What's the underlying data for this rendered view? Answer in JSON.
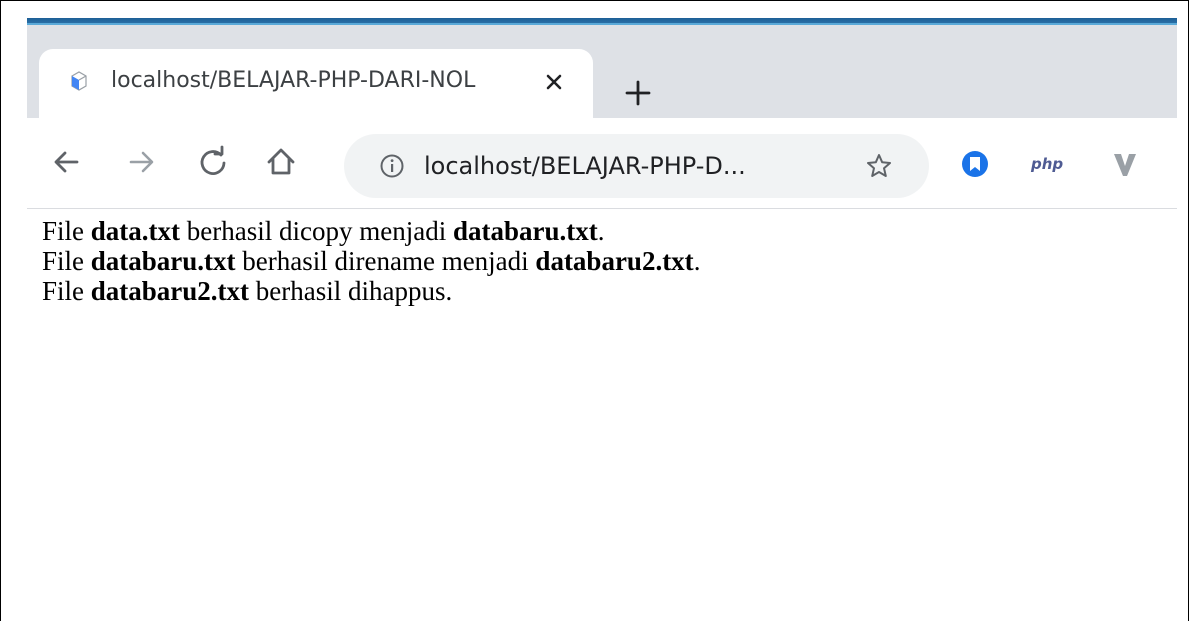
{
  "browser": {
    "tab": {
      "title": "localhost/BELAJAR-PHP-DARI-NOL",
      "favicon": "page-cube-icon",
      "close_icon": "close-icon"
    },
    "new_tab_icon": "plus-icon",
    "toolbar": {
      "back_icon": "back-arrow-icon",
      "forward_icon": "forward-arrow-icon",
      "reload_icon": "reload-icon",
      "home_icon": "home-icon",
      "info_icon": "info-icon",
      "address": "localhost/BELAJAR-PHP-D...",
      "bookmark_icon": "star-icon"
    },
    "extensions": {
      "blue_ext_icon": "blue-bookmark-extension-icon",
      "php_label": "php",
      "v_ext_icon": "v-logo-extension-icon"
    },
    "colors": {
      "tabstrip": "#dee1e6",
      "accent": "#1d5f97",
      "omnibox": "#f1f3f4",
      "blue_ext": "#1a73e8"
    }
  },
  "page": {
    "lines": [
      {
        "prefix": "File ",
        "file": "data.txt",
        "middle": " berhasil dicopy menjadi ",
        "target": "databaru.txt",
        "suffix": "."
      },
      {
        "prefix": "File ",
        "file": "databaru.txt",
        "middle": " berhasil direname menjadi ",
        "target": "databaru2.txt",
        "suffix": "."
      },
      {
        "prefix": "File ",
        "file": "databaru2.txt",
        "middle": " berhasil dihappus."
      }
    ]
  }
}
